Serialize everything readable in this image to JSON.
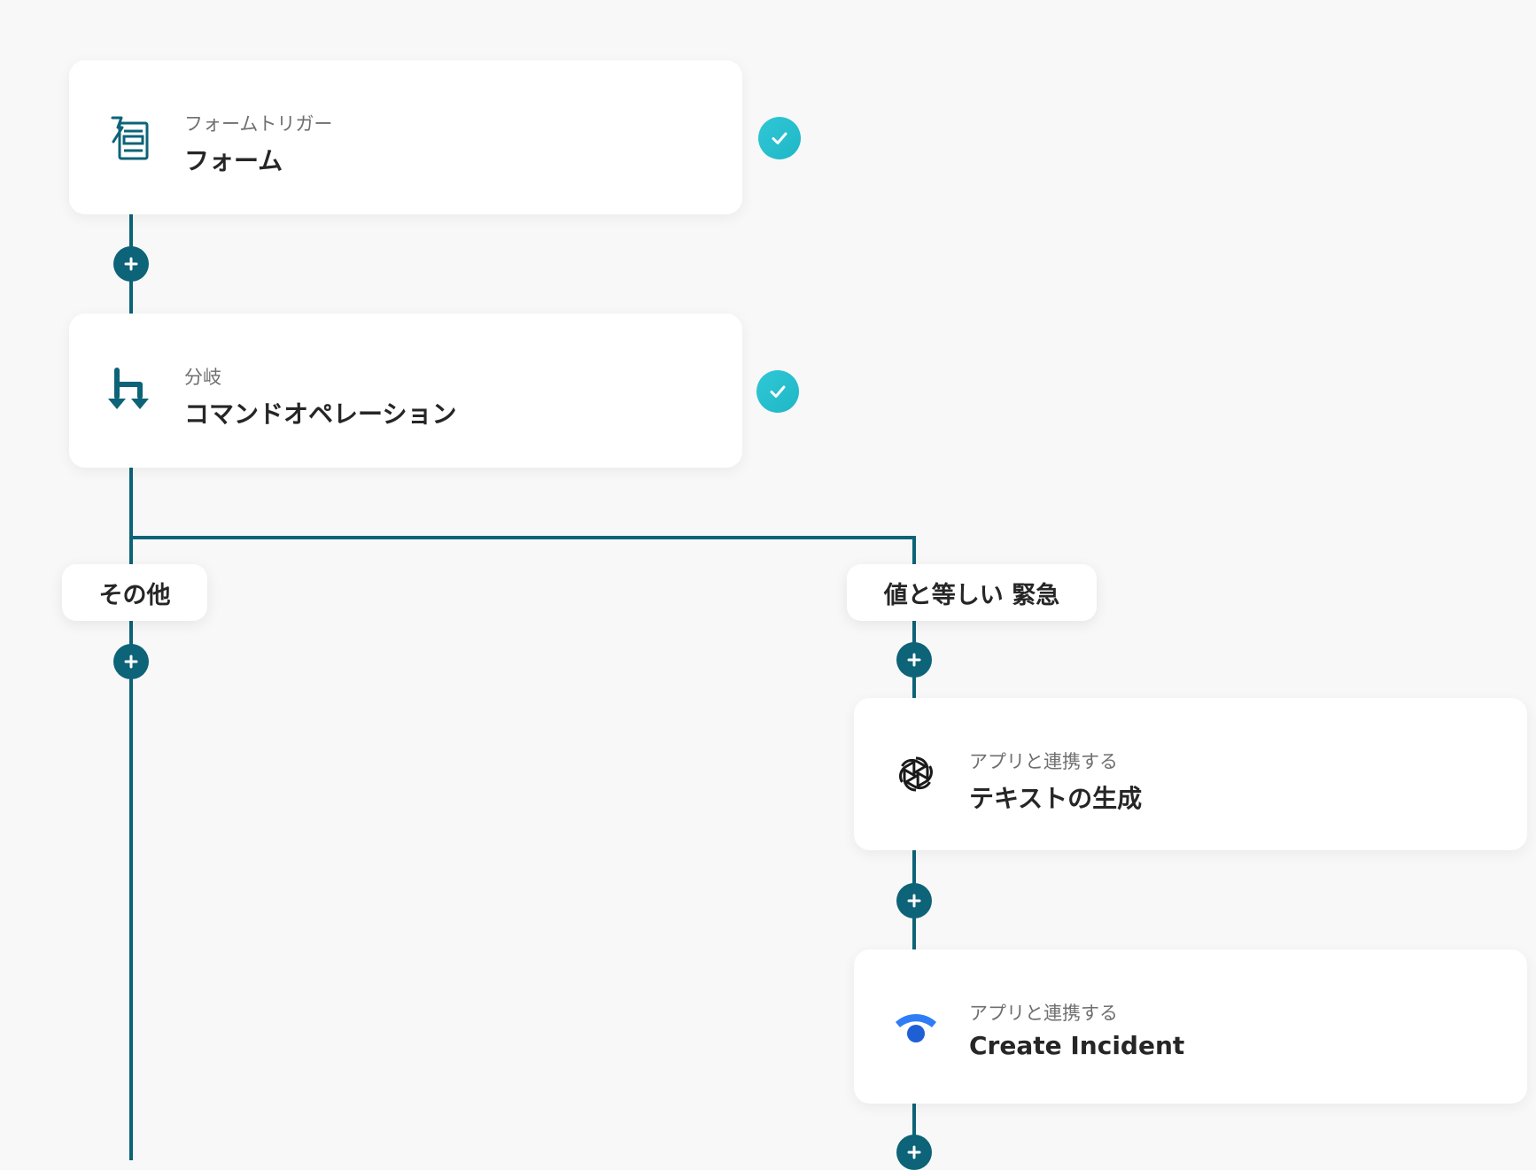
{
  "colors": {
    "accent": "#0d6378",
    "check": "#20c0cf",
    "background": "#f8f8f8",
    "card": "#ffffff",
    "statuspage_blue": "#2f7df6"
  },
  "steps": [
    {
      "subtitle": "フォームトリガー",
      "title": "フォーム",
      "icon": "form-trigger-icon",
      "completed": true
    },
    {
      "subtitle": "分岐",
      "title": "コマンドオペレーション",
      "icon": "branch-icon",
      "completed": true
    }
  ],
  "branches": {
    "left": {
      "label": "その他"
    },
    "right": {
      "label": "値と等しい 緊急",
      "steps": [
        {
          "subtitle": "アプリと連携する",
          "title": "テキストの生成",
          "icon": "openai-icon"
        },
        {
          "subtitle": "アプリと連携する",
          "title": "Create Incident",
          "icon": "statuspage-icon"
        }
      ]
    }
  }
}
